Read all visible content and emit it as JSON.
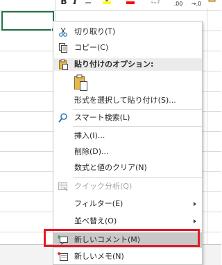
{
  "mini_toolbar": {
    "icons": [
      "bold-icon",
      "italic-icon",
      "underline-icon",
      "highlight-icon",
      "font-color-icon",
      "borders-icon",
      "decrease-decimal-icon",
      "format-painter-icon"
    ],
    "bold_label": "B",
    "italic_label": "I",
    "decimal_label": ".00",
    "decimal2_label": "→.0"
  },
  "context_menu": {
    "cut": "切り取り(T)",
    "copy": "コピー(C)",
    "paste_options_header": "貼り付けのオプション:",
    "paste_special": "形式を選択して貼り付け(S)...",
    "smart_lookup": "スマート検索(L)",
    "insert": "挿入(I)...",
    "delete": "削除(D)...",
    "clear_contents": "数式と値のクリア(N)",
    "quick_analysis": "クイック分析(Q)",
    "filter": "フィルター(E)",
    "sort": "並べ替え(O)",
    "new_comment": "新しいコメント(M)",
    "new_note": "新しいメモ(N)"
  },
  "colors": {
    "accent_green": "#217346",
    "highlight_box": "#e41b23",
    "hover_bg": "#c8c8c8",
    "disabled_text": "#a6a6a6",
    "highlight_yellow": "#ffff00",
    "font_red": "#ff0000"
  }
}
